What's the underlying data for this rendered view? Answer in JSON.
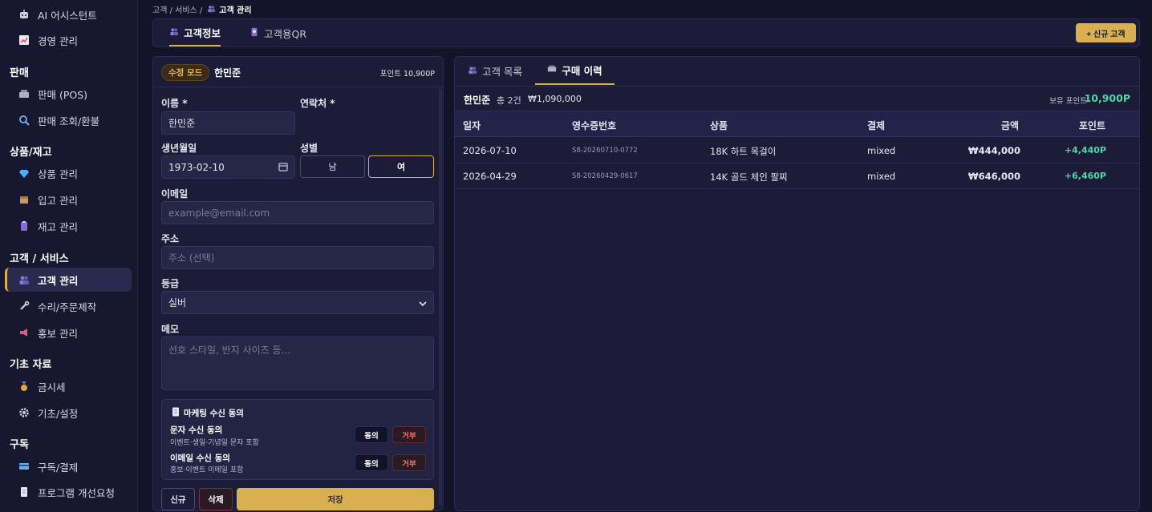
{
  "sidebar": {
    "items_top": [
      {
        "label": "AI 어시스턴트",
        "icon": "robot-icon"
      },
      {
        "label": "경영 관리",
        "icon": "chart-icon"
      }
    ],
    "sections": [
      {
        "title": "판매",
        "items": [
          {
            "label": "판매 (POS)",
            "icon": "register-icon"
          },
          {
            "label": "판매 조회/환불",
            "icon": "search-icon"
          }
        ]
      },
      {
        "title": "상품/재고",
        "items": [
          {
            "label": "상품 관리",
            "icon": "gem-icon"
          },
          {
            "label": "입고 관리",
            "icon": "box-icon"
          },
          {
            "label": "재고 관리",
            "icon": "clipboard-icon"
          }
        ]
      },
      {
        "title": "고객 / 서비스",
        "items": [
          {
            "label": "고객 관리",
            "icon": "users-icon"
          },
          {
            "label": "수리/주문제작",
            "icon": "wrench-icon"
          },
          {
            "label": "홍보 관리",
            "icon": "megaphone-icon"
          }
        ]
      },
      {
        "title": "기초 자료",
        "items": [
          {
            "label": "금시세",
            "icon": "medal-icon"
          },
          {
            "label": "기초/설정",
            "icon": "gear-icon"
          }
        ]
      },
      {
        "title": "구독",
        "items": [
          {
            "label": "구독/결제",
            "icon": "card-icon"
          },
          {
            "label": "프로그램 개선요청",
            "icon": "document-icon"
          }
        ]
      }
    ]
  },
  "breadcrumb": {
    "parent": "고객 / 서비스 /",
    "current": "고객 관리"
  },
  "tabs": {
    "info": "고객정보",
    "qr": "고객용QR",
    "new_button": "+ 신규 고객"
  },
  "form": {
    "mode_badge": "수정 모드",
    "name_display": "한민준",
    "points": "포인트 10,900P",
    "name_label": "이름 *",
    "name_value": "한민준",
    "phone_label": "연락처 *",
    "birth_label": "생년월일",
    "birth_value": "1973-02-10",
    "gender_label": "성별",
    "gender_m": "남",
    "gender_f": "여",
    "email_label": "이메일",
    "email_placeholder": "example@email.com",
    "address_label": "주소",
    "address_placeholder": "주소 (선택)",
    "grade_label": "등급",
    "grade_value": "실버",
    "memo_label": "메모",
    "memo_placeholder": "선호 스타일, 반지 사이즈 등...",
    "marketing": {
      "title": "마케팅 수신 동의",
      "sms_title": "문자 수신 동의",
      "sms_desc": "이벤트·생일·기념일 문자 포함",
      "email_title": "이메일 수신 동의",
      "email_desc": "홍보·이벤트 이메일 포함",
      "agree": "동의",
      "reject": "거부"
    },
    "btn_new": "신규",
    "btn_delete": "삭제",
    "btn_save": "저장"
  },
  "history": {
    "tab_list": "고객 목록",
    "tab_history": "구매 이력",
    "customer": "한민준",
    "count": "총 2건",
    "total": "₩1,090,000",
    "points_label": "보유 포인트",
    "points_value": "10,900P",
    "columns": [
      "일자",
      "영수증번호",
      "상품",
      "결제",
      "금액",
      "포인트"
    ],
    "rows": [
      {
        "date": "2026-07-10",
        "receipt": "S8-20260710-0772",
        "product": "18K 하트 목걸이",
        "payment": "mixed",
        "amount": "₩444,000",
        "points": "+4,440P"
      },
      {
        "date": "2026-04-29",
        "receipt": "S8-20260429-0617",
        "product": "14K 골드 체인 팔찌",
        "payment": "mixed",
        "amount": "₩646,000",
        "points": "+6,460P"
      }
    ]
  },
  "colors": {
    "accent": "#d9b04f",
    "positive": "#4ed8a8",
    "danger": "#e87070"
  }
}
